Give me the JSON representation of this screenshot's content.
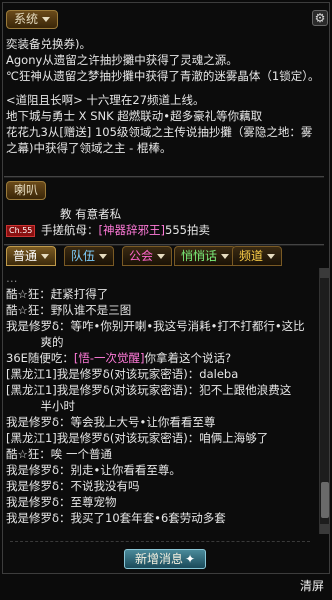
{
  "header": {
    "system_label": "系统",
    "settings_icon": "gear-icon"
  },
  "system_lines": [
    {
      "text": "奕装备兑换券)。",
      "color": "#e6e6e6"
    },
    {
      "text": "Agony从遗留之许抽抄攤中获得了灵魂之源。",
      "color": "#e6e6e6"
    },
    {
      "text": "℃狂神从遗留之梦抽抄攤中获得了青澈的迷雾晶体（1锁定）。",
      "color": "#e6e6e6"
    },
    {
      "text": "",
      "color": "#e6e6e6"
    },
    {
      "text": "<道阻且长啊> 十六理在27频道上线。",
      "color": "#e6e6e6"
    },
    {
      "text": "地下城与勇士 X SNK 超燃联动•超多豪礼等你藕取",
      "color": "#e6e6e6"
    },
    {
      "text": "花花九3从[赠送] 105级领域之主传说抽抄攤（雾隐之地：雾之幕)中获得了领域之主 - 棍棒。",
      "color": "#e6e6e6"
    }
  ],
  "speaker": {
    "label": "喇叭",
    "line1_text": "教 有意者私",
    "ch_badge": "Ch.55",
    "sender": "手搓航母",
    "item": "[神器辞邪王]",
    "suffix": "555拍卖"
  },
  "tabs": [
    {
      "label": "普通",
      "active": true,
      "caret": true
    },
    {
      "label": "队伍",
      "active": false,
      "caret": true
    },
    {
      "label": "公会",
      "active": false,
      "caret": true
    },
    {
      "label": "悄悄话",
      "active": false,
      "caret": true
    },
    {
      "label": "频道",
      "active": false,
      "caret": true
    }
  ],
  "chat_lines": [
    {
      "parts": [
        {
          "t": "…",
          "c": "#888"
        }
      ]
    },
    {
      "parts": [
        {
          "t": "酷☆狂：赶紧打得了",
          "c": "#e6e6e6"
        }
      ]
    },
    {
      "parts": [
        {
          "t": "酷☆狂：野队谁不是三图",
          "c": "#e6e6e6"
        }
      ]
    },
    {
      "parts": [
        {
          "t": "我是修罗δ：等咋•你别开喇•我这号消耗•打不打都行•这比",
          "c": "#e6e6e6"
        }
      ]
    },
    {
      "parts": [
        {
          "t": "　　　爽的",
          "c": "#e6e6e6"
        }
      ]
    },
    {
      "parts": [
        {
          "t": "36E随便吃：",
          "c": "#e6e6e6"
        },
        {
          "t": "[悟-一次觉醒]",
          "c": "#ff7ad9"
        },
        {
          "t": "你拿着这个说话?",
          "c": "#e6e6e6"
        }
      ]
    },
    {
      "parts": [
        {
          "t": "[黑龙江1]我是修罗δ(对该玩家密语)：daleba",
          "c": "#e6e6e6"
        }
      ]
    },
    {
      "parts": [
        {
          "t": "[黑龙江1]我是修罗δ(对该玩家密语)：犯不上跟他浪费这",
          "c": "#e6e6e6"
        }
      ]
    },
    {
      "parts": [
        {
          "t": "　　　半小时",
          "c": "#e6e6e6"
        }
      ]
    },
    {
      "parts": [
        {
          "t": "我是修罗δ：等会我上大号•让你看看至尊",
          "c": "#e6e6e6"
        }
      ]
    },
    {
      "parts": [
        {
          "t": "[黑龙江1]我是修罗δ(对该玩家密语)：咱俩上海够了",
          "c": "#e6e6e6"
        }
      ]
    },
    {
      "parts": [
        {
          "t": "酷☆狂：唉 一个普通",
          "c": "#e6e6e6"
        }
      ]
    },
    {
      "parts": [
        {
          "t": "我是修罗δ：别走•让你看看至尊。",
          "c": "#e6e6e6"
        }
      ]
    },
    {
      "parts": [
        {
          "t": "我是修罗δ：不说我没有吗",
          "c": "#e6e6e6"
        }
      ]
    },
    {
      "parts": [
        {
          "t": "我是修罗δ：至尊宠物",
          "c": "#e6e6e6"
        }
      ]
    },
    {
      "parts": [
        {
          "t": "我是修罗δ：我买了10套年套•6套劳动多套",
          "c": "#e6e6e6"
        }
      ]
    }
  ],
  "new_message_button": "新增消息",
  "clear_button": "清屏"
}
